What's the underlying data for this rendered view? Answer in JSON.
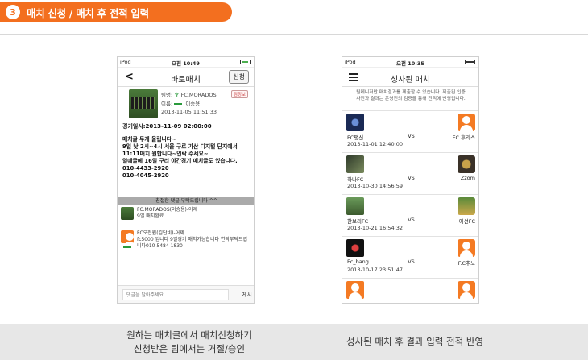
{
  "header": {
    "step_number": "3",
    "title": "매치 신청 / 매치 후 전적 입력"
  },
  "captions": {
    "left_line1": "원하는 매치글에서 매치신청하기",
    "left_line2": "신청받은 팀에서는 거절/승인",
    "right": "성사된 매치 후 결과 입력 전적 반영"
  },
  "phone_a": {
    "status": {
      "device": "iPod",
      "time": "오전 10:49"
    },
    "nav": {
      "title": "바로매치",
      "apply_label": "신청"
    },
    "post": {
      "team_label": "팀명:",
      "team_name": "FC.MORADOS",
      "tag_label": "팀정보",
      "name_label": "이름:",
      "name_value": "이승용",
      "posted_at": "2013-11-05 11:51:33",
      "match_datetime": "경기일시:2013-11-09 02:00:00",
      "body_lines": [
        "매치글 두개 올립니다~",
        "9일 낮 2시~4시 서울 구로 가산 디지털 단지에서",
        "11:11매치 원합니다~연락 주세요~",
        "일에글에 16일 구리 야간경기 매치글도 있습니다.",
        "010-4433-2920",
        "010-4045-2920"
      ]
    },
    "comment_header": "친절한 댓글 부탁드립니다 ^^",
    "comments": [
      {
        "line1": "FC.MORADOS(이승용)-어제",
        "line2": "9일 매치완료",
        "line3": ""
      },
      {
        "line1": "FC오전원(김단비)-어제",
        "line2": "fc5000 입니다 9일경기 매치가능합니다 연락부탁드립",
        "line3": "니다010 5484 1830"
      }
    ],
    "reply_placeholder": "댓글을 달아주세요.",
    "post_label": "게시",
    "colors": {
      "accent": "#2a9a3c"
    }
  },
  "phone_b": {
    "status": {
      "device": "iPod",
      "time": "오전 10:35"
    },
    "nav": {
      "title": "성사된 매치"
    },
    "notice_line1": "팀메니저만 매치결과를 제출할 수 있습니다. 제출된 인증",
    "notice_line2": "사진과 결과는 운영진의 검증을 통해 전적에 반영됩니다.",
    "matches": [
      {
        "home": "FC평신",
        "vs": "VS",
        "away": "FC 후리스",
        "date": "2013-11-01 12:40:00"
      },
      {
        "home": "하나FC",
        "vs": "VS",
        "away": "Zzom",
        "date": "2013-10-30 14:56:59"
      },
      {
        "home": "한보리FC",
        "vs": "VS",
        "away": "어선FC",
        "date": "2013-10-21 16:54:32"
      },
      {
        "home": "Fc_bang",
        "vs": "VS",
        "away": "F.C추노",
        "date": "2013-10-17 23:51:47"
      }
    ]
  },
  "colors": {
    "brand_orange": "#f36f1f",
    "caption_bg": "#e7e7e7"
  }
}
